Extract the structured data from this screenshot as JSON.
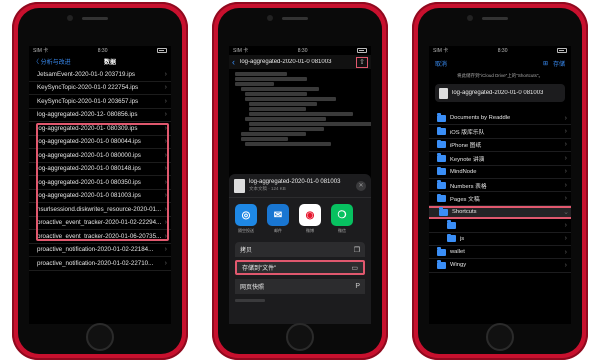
{
  "phone1": {
    "status": {
      "carrier": "SIM 卡",
      "time": "8:30"
    },
    "nav": {
      "back_label": "〈 分析与改进",
      "title": "数据"
    },
    "rows": [
      "JetsamEvent-2020-01-0 203719.ips",
      "KeySyncTopic-2020-01-0 222754.ips",
      "KeySyncTopic-2020-01-0 203657.ips",
      "log-aggregated-2020-12- 080856.ips",
      "log-aggregated-2020-01- 080309.ips",
      "log-aggregated-2020-01-0 080044.ips",
      "log-aggregated-2020-01-0 080000.ips",
      "log-aggregated-2020-01-0 080148.ips",
      "log-aggregated-2020-01-0 080350.ips",
      "log-aggregated-2020-01-0 081003.ips",
      "nsurlsessiond.diskwrites_resource-2020-01...",
      "proactive_event_tracker-2020-01-02-22294...",
      "proactive_event_tracker-2020-01-06-20735...",
      "proactive_notification-2020-01-02-22184...",
      "proactive_notification-2020-01-02-22710..."
    ]
  },
  "phone2": {
    "status": {
      "carrier": "SIM 卡",
      "time": "8:30"
    },
    "nav": {
      "file_title": "log-aggregated-2020-01-0 081003"
    },
    "sheet": {
      "file_name": "log-aggregated-2020-01-0 081003",
      "file_meta": "文本文稿 · 124 KB",
      "apps": [
        {
          "label": "隔空投送",
          "icon": "airdrop-icon",
          "color": "#1e88e5"
        },
        {
          "label": "邮件",
          "icon": "mail-icon",
          "color": "#1976d2"
        },
        {
          "label": "微博",
          "icon": "weibo-icon",
          "color": "#ffffff"
        },
        {
          "label": "微信",
          "icon": "wechat-icon",
          "color": "#07c160"
        }
      ],
      "actions": [
        {
          "label": "拷贝",
          "icon": "copy-icon"
        },
        {
          "label": "存储到\"文件\"",
          "icon": "folder-icon"
        },
        {
          "label": "网页快照",
          "icon": "pinterest-icon"
        }
      ]
    }
  },
  "phone3": {
    "status": {
      "carrier": "SIM 卡",
      "time": "8:30"
    },
    "nav": {
      "cancel_label": "取消",
      "save_label": "存储"
    },
    "hint": "将此储存到\"iCloud Drive\"上的\"Shortcuts\"。",
    "file_name": "log-aggregated-2020-01-0 081003",
    "folders": [
      {
        "label": "Documents by Readdle",
        "sub": false
      },
      {
        "label": "iOS 版库乐队",
        "sub": false
      },
      {
        "label": "iPhone 图纸",
        "sub": false
      },
      {
        "label": "Keynote 讲演",
        "sub": false
      },
      {
        "label": "MindNode",
        "sub": false
      },
      {
        "label": "Numbers 表格",
        "sub": false
      },
      {
        "label": "Pages 文稿",
        "sub": false
      },
      {
        "label": "Shortcuts",
        "sub": false,
        "selected": true
      },
      {
        "label": "",
        "sub": true
      },
      {
        "label": "js",
        "sub": true
      },
      {
        "label": "wallet",
        "sub": false
      },
      {
        "label": "Wingy",
        "sub": false
      }
    ]
  },
  "colors": {
    "highlight": "#e0586e",
    "accent": "#3a8ef6",
    "phone_body": "#c8102e"
  }
}
